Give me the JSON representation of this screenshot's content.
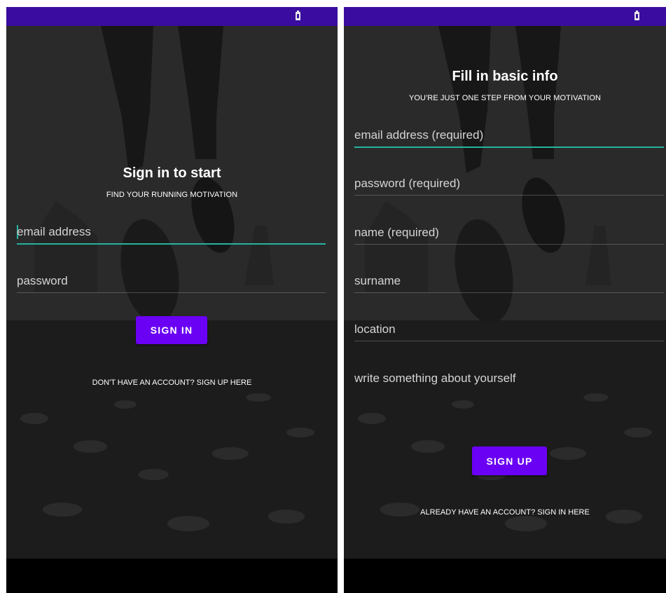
{
  "colors": {
    "status_bar": "#3a0ca0",
    "button": "#6a00f4",
    "focus_underline": "#26b3a0",
    "overlay": "#1e1e1e"
  },
  "sign_in_screen": {
    "status_icon": "battery-icon",
    "title": "Sign in to start",
    "subtitle": "FIND YOUR RUNNING MOTIVATION",
    "fields": [
      {
        "label": "email address",
        "focused": true
      },
      {
        "label": "password",
        "focused": false
      }
    ],
    "button_label": "SIGN IN",
    "link_text": "DON'T HAVE AN ACCOUNT? SIGN UP HERE"
  },
  "sign_up_screen": {
    "status_icon": "battery-icon",
    "title": "Fill in basic info",
    "subtitle": "YOU'RE JUST ONE STEP FROM YOUR MOTIVATION",
    "fields": [
      {
        "label": "email address (required)",
        "focused": true
      },
      {
        "label": "password (required)",
        "focused": false
      },
      {
        "label": "name (required)",
        "focused": false
      },
      {
        "label": "surname",
        "focused": false
      },
      {
        "label": "location",
        "focused": false
      },
      {
        "label": "write something about yourself",
        "focused": false
      }
    ],
    "button_label": "SIGN UP",
    "link_text": "ALREADY HAVE AN ACCOUNT? SIGN IN HERE"
  }
}
